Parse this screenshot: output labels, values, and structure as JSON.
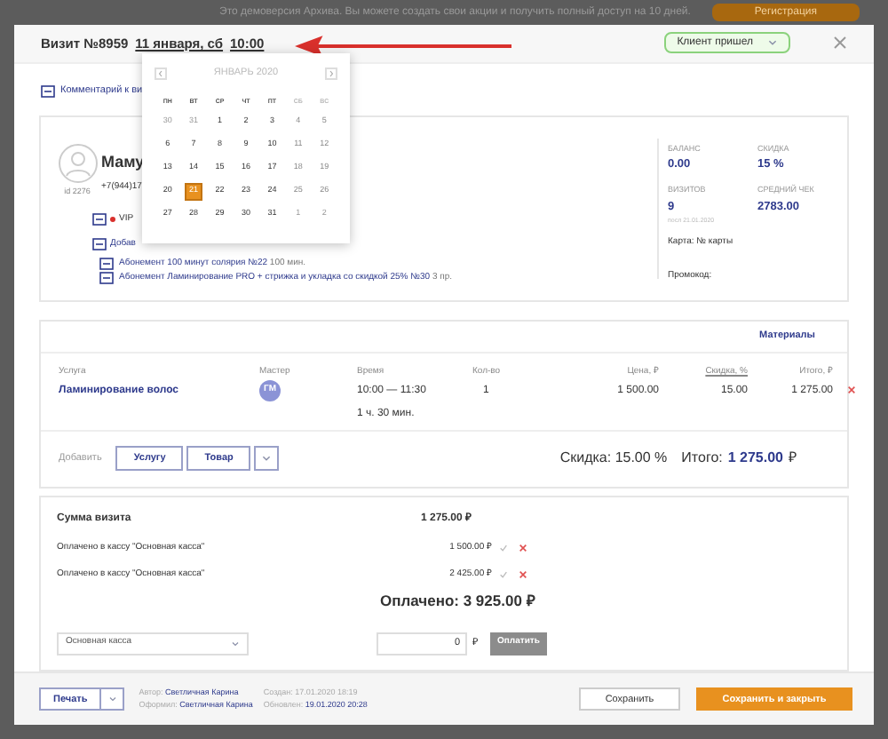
{
  "banner": {
    "text": "Это демоверсия Архива. Вы можете создать свои акции и получить полный доступ на 10 дней.",
    "button": "Регистрация"
  },
  "header": {
    "title": "Визит №8959",
    "date": "11 января, сб",
    "time": "10:00",
    "status": "Клиент пришел"
  },
  "comment_link": "Комментарий к ви",
  "calendar": {
    "month": "ЯНВАРЬ 2020",
    "weekdays": [
      "ПН",
      "ВТ",
      "СР",
      "ЧТ",
      "ПТ",
      "СБ",
      "ВС"
    ],
    "weeks": [
      [
        {
          "d": "30",
          "kind": "other",
          "selected": false
        },
        {
          "d": "31",
          "kind": "other",
          "selected": false
        },
        {
          "d": "1",
          "kind": "day",
          "selected": false
        },
        {
          "d": "2",
          "kind": "day",
          "selected": false
        },
        {
          "d": "3",
          "kind": "day",
          "selected": false
        },
        {
          "d": "4",
          "kind": "weekend",
          "selected": false
        },
        {
          "d": "5",
          "kind": "weekend",
          "selected": false
        }
      ],
      [
        {
          "d": "6",
          "kind": "day",
          "selected": false
        },
        {
          "d": "7",
          "kind": "day",
          "selected": false
        },
        {
          "d": "8",
          "kind": "day",
          "selected": false
        },
        {
          "d": "9",
          "kind": "day",
          "selected": false
        },
        {
          "d": "10",
          "kind": "day",
          "selected": false
        },
        {
          "d": "11",
          "kind": "weekend",
          "selected": false
        },
        {
          "d": "12",
          "kind": "weekend",
          "selected": false
        }
      ],
      [
        {
          "d": "13",
          "kind": "day",
          "selected": false
        },
        {
          "d": "14",
          "kind": "day",
          "selected": false
        },
        {
          "d": "15",
          "kind": "day",
          "selected": false
        },
        {
          "d": "16",
          "kind": "day",
          "selected": false
        },
        {
          "d": "17",
          "kind": "day",
          "selected": false
        },
        {
          "d": "18",
          "kind": "weekend",
          "selected": false
        },
        {
          "d": "19",
          "kind": "weekend",
          "selected": false
        }
      ],
      [
        {
          "d": "20",
          "kind": "day",
          "selected": false
        },
        {
          "d": "21",
          "kind": "day",
          "selected": true
        },
        {
          "d": "22",
          "kind": "day",
          "selected": false
        },
        {
          "d": "23",
          "kind": "day",
          "selected": false
        },
        {
          "d": "24",
          "kind": "day",
          "selected": false
        },
        {
          "d": "25",
          "kind": "weekend",
          "selected": false
        },
        {
          "d": "26",
          "kind": "weekend",
          "selected": false
        }
      ],
      [
        {
          "d": "27",
          "kind": "day",
          "selected": false
        },
        {
          "d": "28",
          "kind": "day",
          "selected": false
        },
        {
          "d": "29",
          "kind": "day",
          "selected": false
        },
        {
          "d": "30",
          "kind": "day",
          "selected": false
        },
        {
          "d": "31",
          "kind": "day",
          "selected": false
        },
        {
          "d": "1",
          "kind": "other",
          "selected": false
        },
        {
          "d": "2",
          "kind": "other",
          "selected": false
        }
      ]
    ]
  },
  "client": {
    "name": "Маму",
    "id": "id 2276",
    "phone": "+7(944)17",
    "tags": [
      {
        "text": "VIP",
        "color": "#d9302c"
      }
    ],
    "add_link": "Добав",
    "subscriptions": [
      {
        "text": "Абонемент 100 минут солярия №22",
        "rest": "100 мин."
      },
      {
        "text": "Абонемент Ламинирование PRO + стрижка и укладка со скидкой 25% №30",
        "rest": "3 пр."
      }
    ],
    "stats": [
      {
        "label": "БАЛАНС",
        "value": "0.00"
      },
      {
        "label": "СКИДКА",
        "value": "15 %"
      },
      {
        "label": "ВИЗИТОВ",
        "value": "9",
        "note": "посл 21.01.2020"
      },
      {
        "label": "СРЕДНИЙ ЧЕК",
        "value": "2783.00"
      }
    ],
    "card": "Карта: № карты",
    "promo": "Промокод:"
  },
  "services": {
    "materials": "Материалы",
    "columns": [
      "Услуга",
      "Мастер",
      "Время",
      "Кол-во",
      "Цена, ₽",
      "Скидка, %",
      "Итого, ₽"
    ],
    "rows": [
      {
        "service": "Ламинирование волос",
        "master": "ГМ",
        "time": "10:00 — 11:30",
        "duration": "1 ч. 30 мин.",
        "qty": "1",
        "price": "1 500.00",
        "discount": "15.00",
        "total": "1 275.00"
      }
    ],
    "add_label": "Добавить",
    "add_buttons": [
      "Услугу",
      "Товар"
    ],
    "discount_summary": "Скидка: 15.00 %",
    "total_label": "Итого:",
    "total": "1 275.00",
    "currency": "₽"
  },
  "payment": {
    "sum_label": "Сумма визита",
    "sum": "1 275.00 ₽",
    "payments": [
      {
        "label": "Оплачено в кассу \"Основная касса\"",
        "amount": "1 500.00 ₽"
      },
      {
        "label": "Оплачено в кассу \"Основная касса\"",
        "amount": "2 425.00 ₽"
      }
    ],
    "paid_total": "Оплачено: 3 925.00 ₽",
    "cashbox": "Основная касса",
    "amount": "0",
    "currency": "₽",
    "pay_button": "Оплатить"
  },
  "footer": {
    "print": "Печать",
    "author_label": "Автор:",
    "author": "Светличная Карина",
    "issuer_label": "Оформил:",
    "issuer": "Светличная Карина",
    "created_label": "Создан:",
    "created": "17.01.2020 18:19",
    "updated_label": "Обновлен:",
    "updated": "19.01.2020 20:28",
    "save": "Сохранить",
    "save_close": "Сохранить и закрыть"
  }
}
